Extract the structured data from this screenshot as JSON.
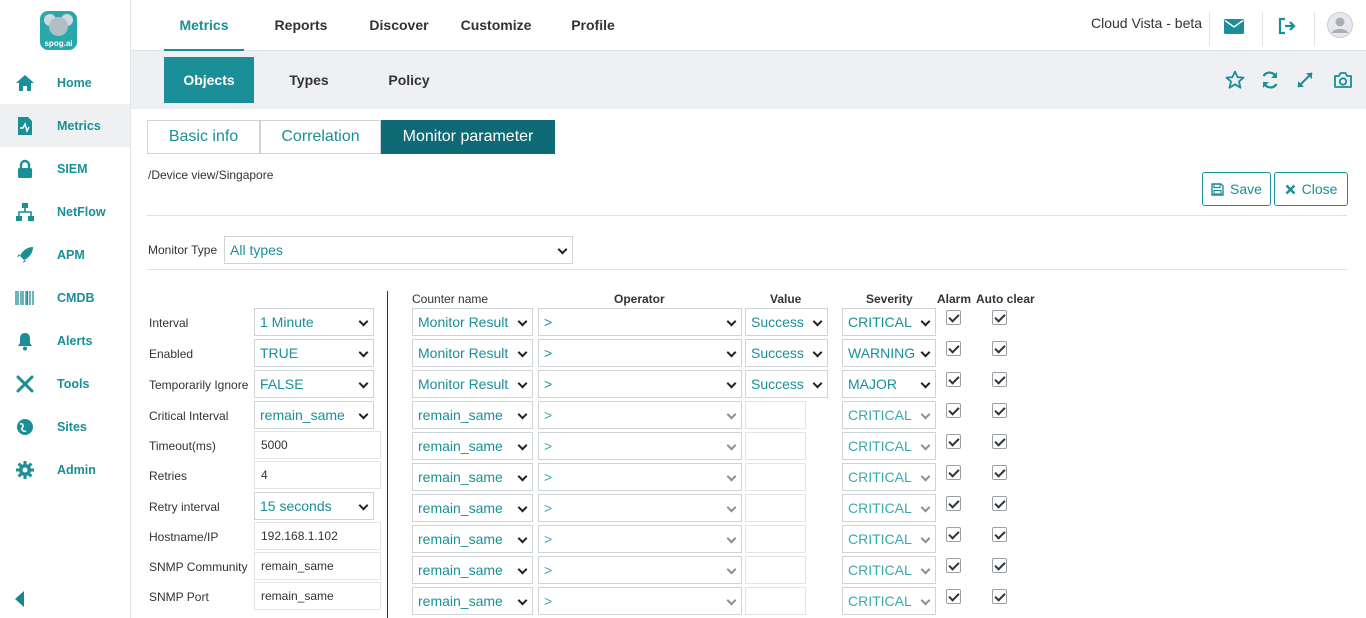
{
  "brand": {
    "logo_text": "spog.ai",
    "app_name": "Cloud Vista - beta"
  },
  "sidebar": {
    "items": [
      {
        "label": "Home",
        "icon": "home-icon"
      },
      {
        "label": "Metrics",
        "icon": "metrics-icon",
        "active": true
      },
      {
        "label": "SIEM",
        "icon": "lock-icon"
      },
      {
        "label": "NetFlow",
        "icon": "network-icon"
      },
      {
        "label": "APM",
        "icon": "rocket-icon"
      },
      {
        "label": "CMDB",
        "icon": "barcode-icon"
      },
      {
        "label": "Alerts",
        "icon": "bell-icon"
      },
      {
        "label": "Tools",
        "icon": "tools-icon"
      },
      {
        "label": "Sites",
        "icon": "globe-icon"
      },
      {
        "label": "Admin",
        "icon": "gear-icon"
      }
    ]
  },
  "topnav": {
    "tabs": [
      "Metrics",
      "Reports",
      "Discover",
      "Customize",
      "Profile"
    ],
    "active": "Metrics"
  },
  "subnav": {
    "tabs": [
      "Objects",
      "Types",
      "Policy"
    ],
    "active": "Objects"
  },
  "segments": {
    "tabs": [
      "Basic info",
      "Correlation",
      "Monitor parameter"
    ],
    "active": "Monitor parameter"
  },
  "breadcrumb": "/Device view/Singapore",
  "actions": {
    "save": "Save",
    "close": "Close"
  },
  "monitor_type": {
    "label": "Monitor Type",
    "value": "All types"
  },
  "params": [
    {
      "label": "Interval",
      "value": "1 Minute",
      "type": "select"
    },
    {
      "label": "Enabled",
      "value": "TRUE",
      "type": "select"
    },
    {
      "label": "Temporarily Ignore",
      "value": "FALSE",
      "type": "select"
    },
    {
      "label": "Critical Interval",
      "value": "remain_same",
      "type": "select"
    },
    {
      "label": "Timeout(ms)",
      "value": "5000",
      "type": "text"
    },
    {
      "label": "Retries",
      "value": "4",
      "type": "text"
    },
    {
      "label": "Retry interval",
      "value": "15 seconds",
      "type": "select"
    },
    {
      "label": "Hostname/IP",
      "value": "192.168.1.102",
      "type": "text"
    },
    {
      "label": "SNMP Community",
      "value": "remain_same",
      "type": "text"
    },
    {
      "label": "SNMP Port",
      "value": "remain_same",
      "type": "text"
    }
  ],
  "thresholds": {
    "headers": {
      "counter": "Counter name",
      "operator": "Operator",
      "value": "Value",
      "severity": "Severity",
      "alarm": "Alarm",
      "auto_clear": "Auto clear"
    },
    "rows": [
      {
        "counter": "Monitor Result",
        "operator": ">",
        "value": "Success",
        "severity": "CRITICAL",
        "alarm": true,
        "auto_clear": true
      },
      {
        "counter": "Monitor Result",
        "operator": ">",
        "value": "Success",
        "severity": "WARNING",
        "alarm": true,
        "auto_clear": true
      },
      {
        "counter": "Monitor Result",
        "operator": ">",
        "value": "Success",
        "severity": "MAJOR",
        "alarm": true,
        "auto_clear": true
      },
      {
        "counter": "remain_same",
        "operator": ">",
        "value": "",
        "severity": "CRITICAL",
        "alarm": true,
        "auto_clear": true
      },
      {
        "counter": "remain_same",
        "operator": ">",
        "value": "",
        "severity": "CRITICAL",
        "alarm": true,
        "auto_clear": true
      },
      {
        "counter": "remain_same",
        "operator": ">",
        "value": "",
        "severity": "CRITICAL",
        "alarm": true,
        "auto_clear": true
      },
      {
        "counter": "remain_same",
        "operator": ">",
        "value": "",
        "severity": "CRITICAL",
        "alarm": true,
        "auto_clear": true
      },
      {
        "counter": "remain_same",
        "operator": ">",
        "value": "",
        "severity": "CRITICAL",
        "alarm": true,
        "auto_clear": true
      },
      {
        "counter": "remain_same",
        "operator": ">",
        "value": "",
        "severity": "CRITICAL",
        "alarm": true,
        "auto_clear": true
      },
      {
        "counter": "remain_same",
        "operator": ">",
        "value": "",
        "severity": "CRITICAL",
        "alarm": true,
        "auto_clear": true
      }
    ]
  },
  "colors": {
    "accent": "#1a8f97",
    "accent_dark": "#0e6b76",
    "subbar_bg": "#eef0f4"
  }
}
